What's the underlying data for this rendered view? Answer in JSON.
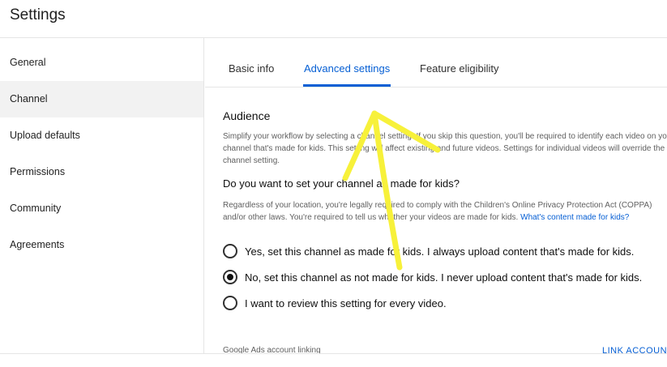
{
  "header": {
    "title": "Settings"
  },
  "sidebar": {
    "items": [
      {
        "label": "General"
      },
      {
        "label": "Channel"
      },
      {
        "label": "Upload defaults"
      },
      {
        "label": "Permissions"
      },
      {
        "label": "Community"
      },
      {
        "label": "Agreements"
      }
    ],
    "active": "Channel"
  },
  "tabs": [
    {
      "label": "Basic info"
    },
    {
      "label": "Advanced settings"
    },
    {
      "label": "Feature eligibility"
    }
  ],
  "audience": {
    "title": "Audience",
    "description": "Simplify your workflow by selecting a channel setting. If you skip this question, you'll be required to identify each video on your channel that's made for kids. This setting will affect existing and future videos. Settings for individual videos will override the channel setting.",
    "question": "Do you want to set your channel as made for kids?",
    "legal": "Regardless of your location, you're legally required to comply with the Children's Online Privacy Protection Act (COPPA) and/or other laws. You're required to tell us whether your videos are made for kids.",
    "legal_link": "What's content made for kids?",
    "options": [
      {
        "label": "Yes, set this channel as made for kids. I always upload content that's made for kids.",
        "checked": false
      },
      {
        "label": "No, set this channel as not made for kids. I never upload content that's made for kids.",
        "checked": true
      },
      {
        "label": "I want to review this setting for every video.",
        "checked": false
      }
    ]
  },
  "google_ads": {
    "label": "Google Ads account linking",
    "link": "LINK ACCOUNT"
  },
  "colors": {
    "accent": "#065fd4",
    "annotation": "#f7f13a",
    "active_nav_bg": "#f2f2f2"
  }
}
